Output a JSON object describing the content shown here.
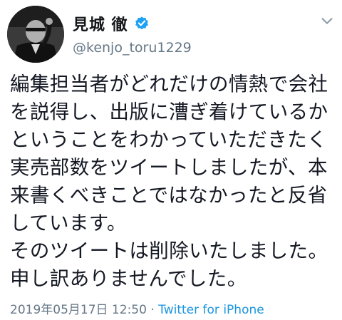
{
  "profile": {
    "display_name": "見城 徹",
    "handle": "@kenjo_toru1229",
    "verified": true,
    "avatar_icon": "profile-photo",
    "verified_icon": "verified-badge-icon"
  },
  "tweet": {
    "text": "編集担当者がどれだけの情熱で会社を説得し、出版に漕ぎ着けているかということをわかっていただきたく実売部数をツイートしましたが、本来書くべきことではなかったと反省しています。\nそのツイートは削除いたしました。申し訳ありませんでした。"
  },
  "meta": {
    "timestamp": "2019年05月17日 12:50",
    "separator": " · ",
    "source": "Twitter for iPhone"
  },
  "colors": {
    "accent": "#1b95e0",
    "verified": "#1da1f2",
    "secondary_text": "#657786"
  }
}
